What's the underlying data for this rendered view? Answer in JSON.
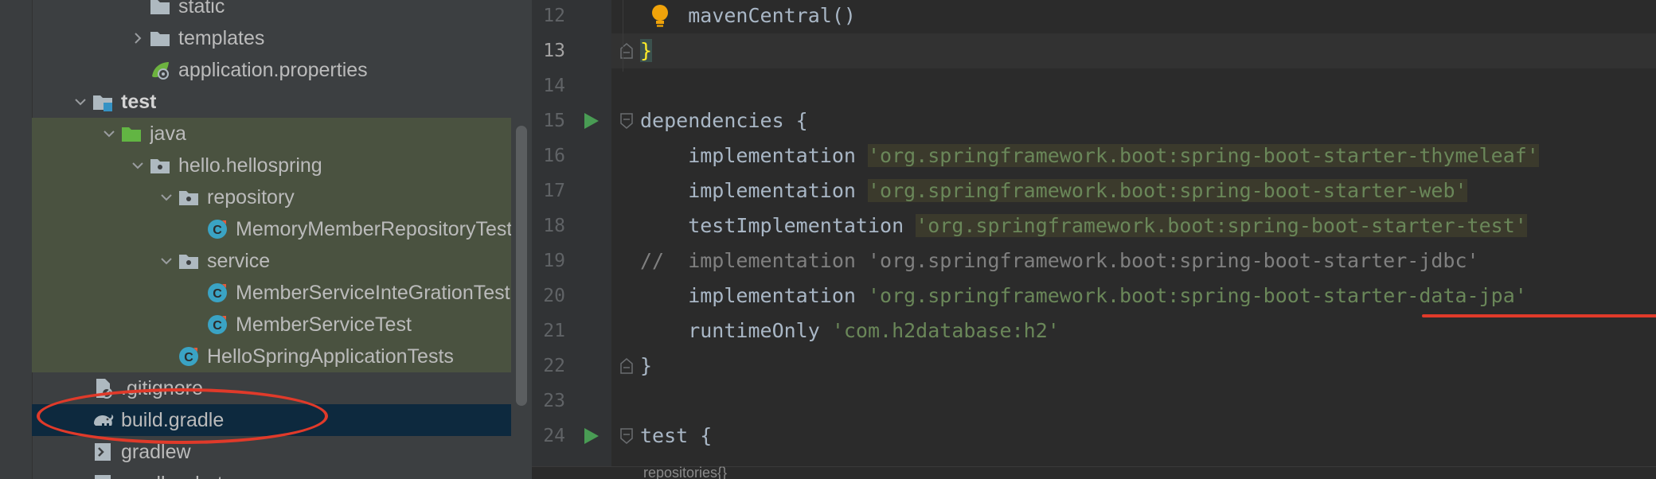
{
  "tree": {
    "rows": [
      {
        "label": "static",
        "indent": 3,
        "chevron": "none",
        "icon": "folder-icon"
      },
      {
        "label": "templates",
        "indent": 3,
        "chevron": "right",
        "icon": "folder-icon"
      },
      {
        "label": "application.properties",
        "indent": 3,
        "chevron": "none",
        "icon": "spring-properties-icon"
      },
      {
        "label": "test",
        "indent": 1,
        "chevron": "down",
        "icon": "test-module-folder-icon",
        "bold": true
      },
      {
        "label": "java",
        "indent": 2,
        "chevron": "down",
        "icon": "test-source-folder-icon",
        "highlight": true
      },
      {
        "label": "hello.hellospring",
        "indent": 3,
        "chevron": "down",
        "icon": "package-icon",
        "highlight": true
      },
      {
        "label": "repository",
        "indent": 4,
        "chevron": "down",
        "icon": "package-icon",
        "highlight": true
      },
      {
        "label": "MemoryMemberRepositoryTest",
        "indent": 5,
        "chevron": "none",
        "icon": "class-icon",
        "highlight": true
      },
      {
        "label": "service",
        "indent": 4,
        "chevron": "down",
        "icon": "package-icon",
        "highlight": true
      },
      {
        "label": "MemberServiceInteGrationTest",
        "indent": 5,
        "chevron": "none",
        "icon": "class-icon",
        "highlight": true
      },
      {
        "label": "MemberServiceTest",
        "indent": 5,
        "chevron": "none",
        "icon": "class-icon",
        "highlight": true
      },
      {
        "label": "HelloSpringApplicationTests",
        "indent": 4,
        "chevron": "none",
        "icon": "class-icon",
        "highlight": true
      },
      {
        "label": ".gitignore",
        "indent": 1,
        "chevron": "none",
        "icon": "ignored-file-icon"
      },
      {
        "label": "build.gradle",
        "indent": 1,
        "chevron": "none",
        "icon": "gradle-elephant-icon",
        "selected": true
      },
      {
        "label": "gradlew",
        "indent": 1,
        "chevron": "none",
        "icon": "shell-script-icon"
      },
      {
        "label": "gradlew.bat",
        "indent": 1,
        "chevron": "none",
        "icon": "batch-file-icon"
      }
    ]
  },
  "editor": {
    "current_line": "13",
    "lines": [
      {
        "num": "12",
        "tokens": [
          {
            "t": "    ",
            "c": "plain"
          },
          {
            "t": "mavenCentral()",
            "c": "plain"
          }
        ],
        "bulb": true
      },
      {
        "num": "13",
        "tokens": [
          {
            "t": "}",
            "c": "brace-match"
          }
        ],
        "fold": true,
        "current": true
      },
      {
        "num": "14",
        "tokens": []
      },
      {
        "num": "15",
        "tokens": [
          {
            "t": "dependencies {",
            "c": "plain"
          }
        ],
        "run": true,
        "fold": true
      },
      {
        "num": "16",
        "tokens": [
          {
            "t": "    implementation ",
            "c": "plain"
          },
          {
            "t": "'org.springframework.boot:spring-boot-starter-thymeleaf'",
            "c": "str-hl"
          }
        ]
      },
      {
        "num": "17",
        "tokens": [
          {
            "t": "    implementation ",
            "c": "plain"
          },
          {
            "t": "'org.springframework.boot:spring-boot-starter-web'",
            "c": "str-hl"
          }
        ]
      },
      {
        "num": "18",
        "tokens": [
          {
            "t": "    testImplementation ",
            "c": "plain"
          },
          {
            "t": "'org.springframework.boot:spring-boot-starter-test'",
            "c": "str-hl"
          }
        ]
      },
      {
        "num": "19",
        "tokens": [
          {
            "t": "//  implementation 'org.springframework.boot:spring-boot-starter-jdbc'",
            "c": "comment"
          }
        ]
      },
      {
        "num": "20",
        "tokens": [
          {
            "t": "    implementation ",
            "c": "plain"
          },
          {
            "t": "'org.springframework.boot:spring-boot-starter-data-jpa'",
            "c": "str"
          }
        ]
      },
      {
        "num": "21",
        "tokens": [
          {
            "t": "    runtimeOnly ",
            "c": "plain"
          },
          {
            "t": "'com.h2database:h2'",
            "c": "str"
          }
        ]
      },
      {
        "num": "22",
        "tokens": [
          {
            "t": "}",
            "c": "plain"
          }
        ],
        "fold": true
      },
      {
        "num": "23",
        "tokens": []
      },
      {
        "num": "24",
        "tokens": [
          {
            "t": "test {",
            "c": "plain"
          }
        ],
        "run": true,
        "fold": true
      }
    ],
    "breadcrumb": "repositories{}"
  },
  "colors": {
    "annotation_red": "#e03a2a",
    "tree_highlight": "#4a5240",
    "selected_row": "#0d293e",
    "string_green": "#6a8759"
  }
}
